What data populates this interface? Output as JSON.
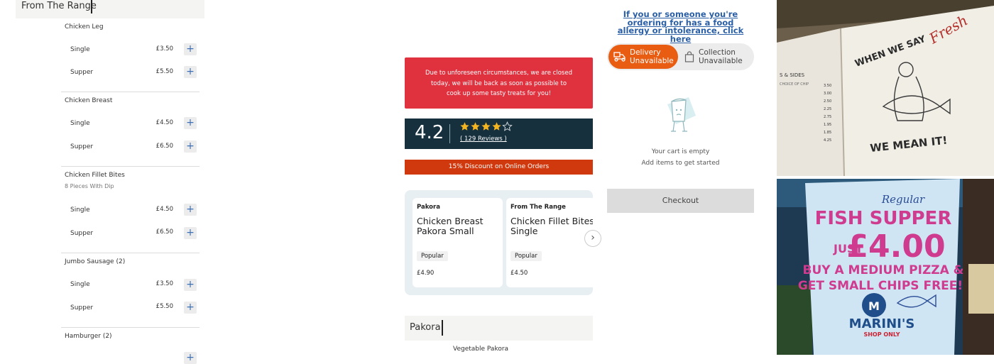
{
  "menu": {
    "section_title": "From The Range",
    "items": [
      {
        "title": "Chicken Leg",
        "options": [
          {
            "label": "Single",
            "price": "£3.50"
          },
          {
            "label": "Supper",
            "price": "£5.50"
          }
        ]
      },
      {
        "title": "Chicken Breast",
        "options": [
          {
            "label": "Single",
            "price": "£4.50"
          },
          {
            "label": "Supper",
            "price": "£6.50"
          }
        ]
      },
      {
        "title": "Chicken Fillet Bites",
        "subtitle": "8 Pieces With Dip",
        "options": [
          {
            "label": "Single",
            "price": "£4.50"
          },
          {
            "label": "Supper",
            "price": "£6.50"
          }
        ]
      },
      {
        "title": "Jumbo Sausage (2)",
        "options": [
          {
            "label": "Single",
            "price": "£3.50"
          },
          {
            "label": "Supper",
            "price": "£5.50"
          }
        ]
      },
      {
        "title": "Hamburger (2)"
      }
    ],
    "add_symbol": "+"
  },
  "notice": {
    "closed_message": "Due to unforeseen circumstances, we are closed today, we will be back as soon as possible to cook up some tasty treats for you!"
  },
  "rating": {
    "value": "4.2",
    "stars": 4.2,
    "reviews_label": "( 129 Reviews )"
  },
  "discount": {
    "text": "15% Discount on Online Orders"
  },
  "carousel": {
    "cards": [
      {
        "category": "Pakora",
        "name": "Chicken Breast Pakora Small",
        "badge": "Popular",
        "price": "£4.90"
      },
      {
        "category": "From The Range",
        "name": "Chicken Fillet Bites Single",
        "badge": "Popular",
        "price": "£4.50"
      }
    ],
    "next_icon": "›"
  },
  "pakora_section": {
    "title": "Pakora",
    "first_item": "Vegetable Pakora"
  },
  "cart": {
    "allergy_link": "If you or someone you're ordering for has a food allergy or intolerance, click here",
    "delivery_label": "Delivery Unavailable",
    "collection_label": "Collection Unavailable",
    "empty_line1": "Your cart is empty",
    "empty_line2": "Add items to get started",
    "checkout_label": "Checkout"
  },
  "photos": {
    "sign_top": "WHEN WE SAY",
    "sign_script": "Fresh",
    "sign_bottom": "WE MEAN IT!",
    "sign_side": "S & SIDES",
    "sign_side_sub": "CHOICE OF CHIP",
    "sign_prices": [
      "3.50",
      "3.00",
      "2.50",
      "2.25",
      "2.75",
      "1.95",
      "1.85",
      "4.25"
    ],
    "poster_regular": "Regular",
    "poster_line1": "FISH SUPPER",
    "poster_just": "JUST",
    "poster_price": "£4.00",
    "poster_line3": "BUY A MEDIUM PIZZA &",
    "poster_line4": "GET SMALL CHIPS FREE!",
    "poster_logo_letter": "M",
    "poster_brand": "MARINI'S",
    "poster_shop": "SHOP ONLY"
  },
  "colors": {
    "closed_red": "#e0313f",
    "rating_navy": "#16303e",
    "discount_orange": "#d0380e",
    "delivery_orange": "#e85d12",
    "link_blue": "#2a5fa6",
    "plus_blue": "#3b6fb6"
  }
}
